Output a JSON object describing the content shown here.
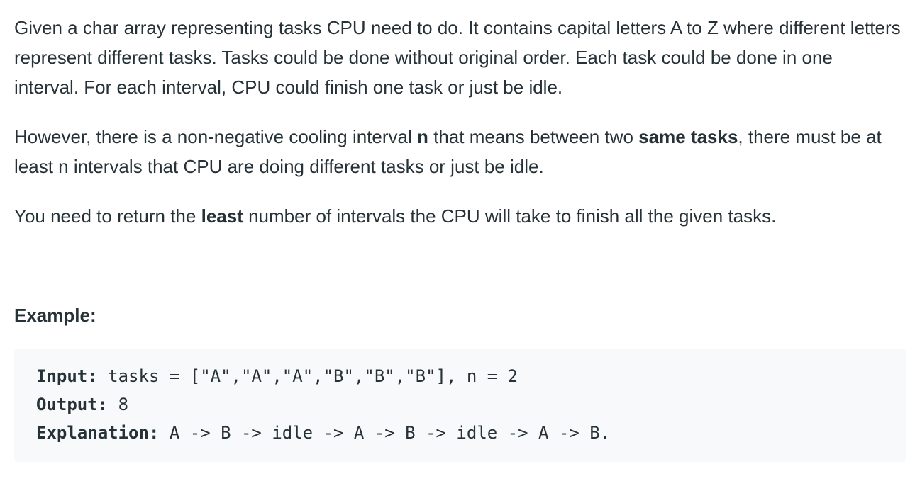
{
  "paragraphs": {
    "p1": "Given a char array representing tasks CPU need to do. It contains capital letters A to Z where different letters represent different tasks. Tasks could be done without original order. Each task could be done in one interval. For each interval, CPU could finish one task or just be idle.",
    "p2_a": "However, there is a non-negative cooling interval ",
    "p2_n": "n",
    "p2_b": " that means between two ",
    "p2_same": "same tasks",
    "p2_c": ", there must be at least n intervals that CPU are doing different tasks or just be idle.",
    "p3_a": "You need to return the ",
    "p3_least": "least",
    "p3_b": " number of intervals the CPU will take to finish all the given tasks."
  },
  "example": {
    "heading": "Example:",
    "input_label": "Input:",
    "input_value": " tasks = [\"A\",\"A\",\"A\",\"B\",\"B\",\"B\"], n = 2",
    "output_label": "Output:",
    "output_value": " 8",
    "explanation_label": "Explanation:",
    "explanation_value": " A -> B -> idle -> A -> B -> idle -> A -> B."
  }
}
